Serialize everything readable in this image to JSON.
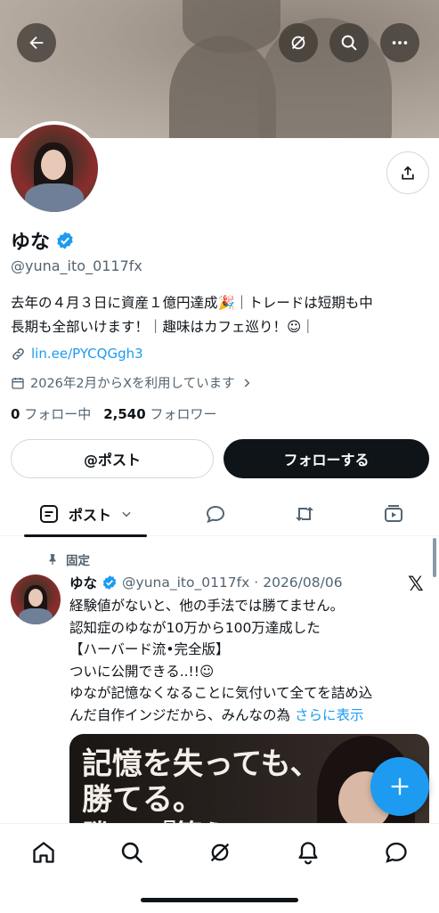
{
  "header": {
    "back_icon": "arrow-left-icon",
    "grok_icon": "grok-icon",
    "search_icon": "search-icon",
    "more_icon": "more-horizontal-icon"
  },
  "profile": {
    "name": "ゆな",
    "verified": true,
    "handle": "@yuna_ito_0117fx",
    "bio_line1": "去年の４月３日に資産１億円達成🎉｜トレードは短期も中",
    "bio_line2": "長期も全部いけます！｜趣味はカフェ巡り！☺︎｜",
    "link": "lin.ee/PYCQGgh3",
    "joined": "2026年2月からXを利用しています",
    "following_count": "0",
    "following_label": "フォロー中",
    "followers_count": "2,540",
    "followers_label": "フォロワー"
  },
  "actions": {
    "post_button": "@ポスト",
    "follow_button": "フォローする"
  },
  "tabs": {
    "active_label": "ポスト"
  },
  "pinned_tweet": {
    "pinned_label": "固定",
    "name": "ゆな",
    "handle": "@yuna_ito_0117fx",
    "separator": "·",
    "date": "2026/08/06",
    "lines": [
      "経験値がないと、他の手法では勝てません。",
      "認知症のゆなが10万から100万達成した",
      "【ハーバード流•完全版】",
      "ついに公開できる..!!☺︎",
      "ゆなが記憶なくなることに気付いて全てを詰め込"
    ],
    "last_line_prefix": "んだ自作インジだから、みんなの為",
    "show_more": "さらに表示",
    "media_line1": "記憶を失っても、",
    "media_line2": "勝てる。",
    "media_line3": "勝　　『策え』"
  },
  "colors": {
    "accent": "#1d9bf0",
    "text": "#0f1419",
    "muted": "#536471"
  }
}
